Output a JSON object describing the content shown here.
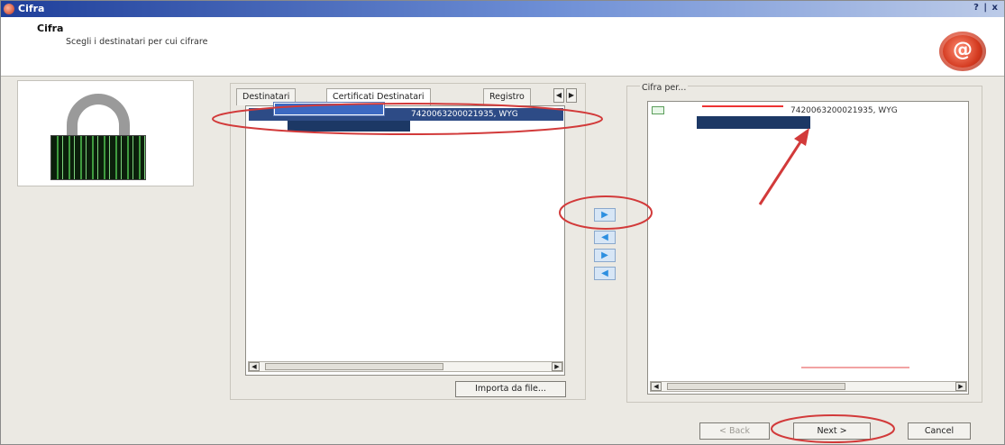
{
  "window": {
    "title": "Cifra",
    "controls": "? | x"
  },
  "header": {
    "title": "Cifra",
    "subtitle": "Scegli i destinatari per cui cifrare"
  },
  "seal": {
    "glyph": "@"
  },
  "left_tabs": [
    {
      "label": "Destinatari"
    },
    {
      "label": "Certificati Destinatari"
    },
    {
      "label": "Registro"
    }
  ],
  "left_list": {
    "row_text": "7420063200021935, WYG"
  },
  "right_panel": {
    "label": "Cifra per...",
    "row_text": "7420063200021935, WYG"
  },
  "buttons": {
    "import": "Importa da file...",
    "back": "< Back",
    "next": "Next >",
    "cancel": "Cancel"
  },
  "arrows": {
    "add": "▶",
    "remove": "◀",
    "add_all": "▶",
    "remove_all": "◀"
  },
  "colors": {
    "annotation": "#d23a3a",
    "selection": "#2d4b86",
    "accent": "#2d8fe0"
  }
}
